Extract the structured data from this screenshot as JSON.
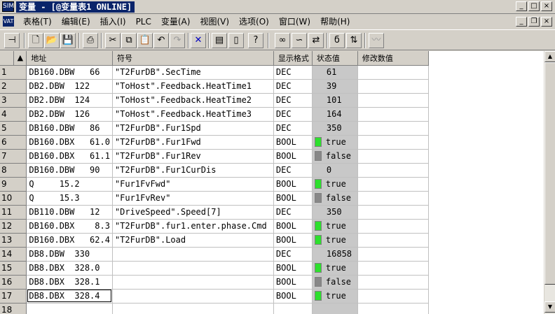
{
  "window": {
    "app_icon": "SIM",
    "title": "变量 - [@变量表1  ONLINE]",
    "minimize": "_",
    "maximize": "□",
    "close": "×"
  },
  "menubar": {
    "doc_icon": "VAT",
    "items": [
      "表格(T)",
      "编辑(E)",
      "插入(I)",
      "PLC",
      "变量(A)",
      "视图(V)",
      "选项(O)",
      "窗口(W)",
      "帮助(H)"
    ],
    "minimize": "_",
    "restore": "❐",
    "close": "×"
  },
  "toolbar": {
    "icons": [
      "pin-icon",
      "new-icon",
      "open-icon",
      "save-icon",
      "print-icon",
      "cut-icon",
      "copy-icon",
      "paste-icon",
      "undo-icon",
      "redo-icon",
      "delete-icon",
      "monitor-icon",
      "modify-icon",
      "help-icon",
      "glasses-icon",
      "monitor-var-icon",
      "trigger-icon",
      "modify-var-icon",
      "trigger-modify-icon",
      "chart-icon"
    ]
  },
  "grid": {
    "headers": {
      "address": "地址",
      "symbol": "符号",
      "display_format": "显示格式",
      "status_value": "状态值",
      "modify_value": "修改数值"
    },
    "rows": [
      {
        "num": "1",
        "address": "DB160.DBW   66",
        "symbol": "\"T2FurDB\".SecTime",
        "format": "DEC",
        "value": "61",
        "led": ""
      },
      {
        "num": "2",
        "address": "DB2.DBW  122",
        "symbol": "\"ToHost\".Feedback.HeatTime1",
        "format": "DEC",
        "value": "39",
        "led": ""
      },
      {
        "num": "3",
        "address": "DB2.DBW  124",
        "symbol": "\"ToHost\".Feedback.HeatTime2",
        "format": "DEC",
        "value": "101",
        "led": ""
      },
      {
        "num": "4",
        "address": "DB2.DBW  126",
        "symbol": "\"ToHost\".Feedback.HeatTime3",
        "format": "DEC",
        "value": "164",
        "led": ""
      },
      {
        "num": "5",
        "address": "DB160.DBW   86",
        "symbol": "\"T2FurDB\".Fur1Spd",
        "format": "DEC",
        "value": "350",
        "led": ""
      },
      {
        "num": "6",
        "address": "DB160.DBX   61.0",
        "symbol": "\"T2FurDB\".Fur1Fwd",
        "format": "BOOL",
        "value": "true",
        "led": "on"
      },
      {
        "num": "7",
        "address": "DB160.DBX   61.1",
        "symbol": "\"T2FurDB\".Fur1Rev",
        "format": "BOOL",
        "value": "false",
        "led": "off"
      },
      {
        "num": "8",
        "address": "DB160.DBW   90",
        "symbol": "\"T2FurDB\".Fur1CurDis",
        "format": "DEC",
        "value": "0",
        "led": ""
      },
      {
        "num": "9",
        "address": "Q     15.2",
        "symbol": "\"Fur1FvFwd\"",
        "format": "BOOL",
        "value": "true",
        "led": "on"
      },
      {
        "num": "10",
        "address": "Q     15.3",
        "symbol": "\"Fur1FvRev\"",
        "format": "BOOL",
        "value": "false",
        "led": "off"
      },
      {
        "num": "11",
        "address": "DB110.DBW   12",
        "symbol": "\"DriveSpeed\".Speed[7]",
        "format": "DEC",
        "value": "350",
        "led": ""
      },
      {
        "num": "12",
        "address": "DB160.DBX    8.3",
        "symbol": "\"T2FurDB\".fur1.enter.phase.Cmd",
        "format": "BOOL",
        "value": "true",
        "led": "on"
      },
      {
        "num": "13",
        "address": "DB160.DBX   62.4",
        "symbol": "\"T2FurDB\".Load",
        "format": "BOOL",
        "value": "true",
        "led": "on"
      },
      {
        "num": "14",
        "address": "DB8.DBW  330",
        "symbol": "",
        "format": "DEC",
        "value": "16858",
        "led": ""
      },
      {
        "num": "15",
        "address": "DB8.DBX  328.0",
        "symbol": "",
        "format": "BOOL",
        "value": "true",
        "led": "on"
      },
      {
        "num": "16",
        "address": "DB8.DBX  328.1",
        "symbol": "",
        "format": "BOOL",
        "value": "false",
        "led": "off"
      },
      {
        "num": "17",
        "address": "DB8.DBX  328.4",
        "symbol": "",
        "format": "BOOL",
        "value": "true",
        "led": "on"
      },
      {
        "num": "18",
        "address": "",
        "symbol": "",
        "format": "",
        "value": "",
        "led": ""
      }
    ]
  },
  "colors": {
    "title_bg": "#0a246a",
    "led_on": "#2de02d",
    "led_off": "#888888",
    "status_bg": "#c8c8c8"
  }
}
